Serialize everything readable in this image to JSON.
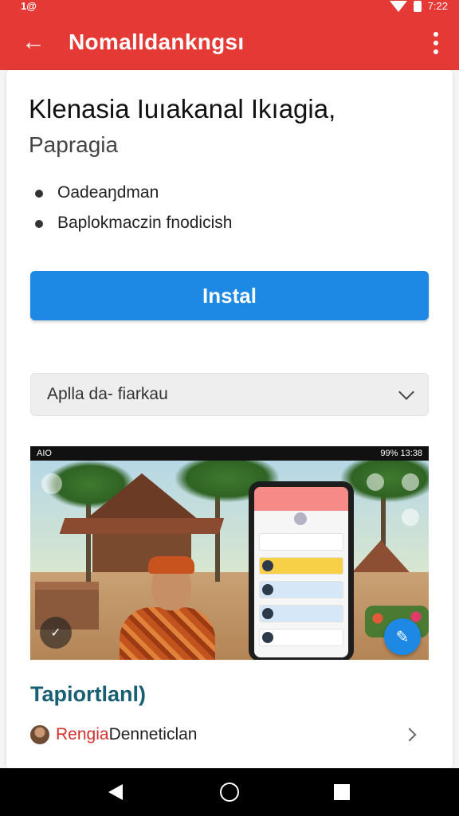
{
  "status_bar": {
    "left_text": "1@",
    "time": "7:22"
  },
  "app_bar": {
    "title": "Nomalldankngsı"
  },
  "content": {
    "title": "Klenasia Iuıakanal Ikıagia,",
    "subtitle": "Papragia",
    "bullets": [
      "Oadeaŋdman",
      "Baplokmaczin fnodicish"
    ],
    "install_label": "Instal",
    "dropdown_value": "Aplla da- fiarkau"
  },
  "screenshot": {
    "status_left": "AIO",
    "status_right": "99% 13:38"
  },
  "section": {
    "heading": "Tapiortlanl)",
    "author_highlight": "Rengia",
    "author_rest": " Denneticlan"
  },
  "colors": {
    "app_bar": "#e53935",
    "install_button": "#1e88e5",
    "section_heading": "#195f73",
    "author_highlight": "#d32f2f"
  },
  "icons": {
    "back": "arrow-left-icon",
    "more": "more-vertical-icon",
    "dropdown": "chevron-down-icon",
    "row_chevron": "chevron-right-icon",
    "nav": [
      "nav-back-icon",
      "nav-home-icon",
      "nav-recents-icon"
    ]
  }
}
